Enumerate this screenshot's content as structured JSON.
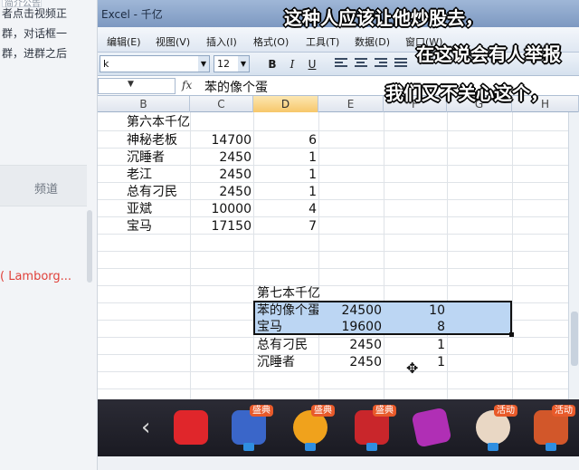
{
  "left_panel": {
    "notice_tab": "简介公告",
    "notice_lines": [
      "者点击视频正",
      "群，对话框一",
      "群，进群之后"
    ],
    "channel_tab": "频道",
    "lambo_text": "( Lamborg..."
  },
  "excel": {
    "title": "Excel - 千亿",
    "menus": [
      "编辑(E)",
      "视图(V)",
      "插入(I)",
      "格式(O)",
      "工具(T)",
      "数据(D)",
      "窗口(W)"
    ],
    "toolbar": {
      "font_name": "k",
      "font_size": "12",
      "bold": "B",
      "italic": "I",
      "underline": "U"
    },
    "formula_bar": {
      "fx": "fx",
      "content": "苯的像个蛋"
    },
    "columns": [
      "B",
      "C",
      "D",
      "E",
      "F",
      "G",
      "H"
    ],
    "selected_column": "D",
    "block1": {
      "title": "第六本千亿",
      "rows": [
        {
          "name": "神秘老板",
          "c": "14700",
          "d": "6"
        },
        {
          "name": "沉睡者",
          "c": "2450",
          "d": "1"
        },
        {
          "name": "老江",
          "c": "2450",
          "d": "1"
        },
        {
          "name": "总有刁民",
          "c": "2450",
          "d": "1"
        },
        {
          "name": "亚斌",
          "c": "10000",
          "d": "4"
        },
        {
          "name": "宝马",
          "c": "17150",
          "d": "7"
        }
      ]
    },
    "block2": {
      "title": "第七本千亿",
      "rows": [
        {
          "name": "苯的像个蛋",
          "e": "24500",
          "f": "10"
        },
        {
          "name": "宝马",
          "e": "19600",
          "f": "8"
        },
        {
          "name": "总有刁民",
          "e": "2450",
          "f": "1"
        },
        {
          "name": "沉睡者",
          "e": "2450",
          "f": "1"
        }
      ]
    }
  },
  "subtitles": [
    "这种人应该让他炒股去，",
    "在这说会有人举报",
    "我们又不关心这个，"
  ],
  "gift_bar": {
    "prev": "‹",
    "gifts": [
      {
        "tag": "",
        "color": "#e0262b"
      },
      {
        "tag": "盛典",
        "color": "#3a66c9"
      },
      {
        "tag": "盛典",
        "color": "#f0a21c"
      },
      {
        "tag": "盛典",
        "color": "#c9262b"
      },
      {
        "tag": "",
        "color": "#b02fb5"
      },
      {
        "tag": "活动",
        "color": "#e9d7c4"
      },
      {
        "tag": "活动",
        "color": "#d2572a"
      }
    ]
  }
}
